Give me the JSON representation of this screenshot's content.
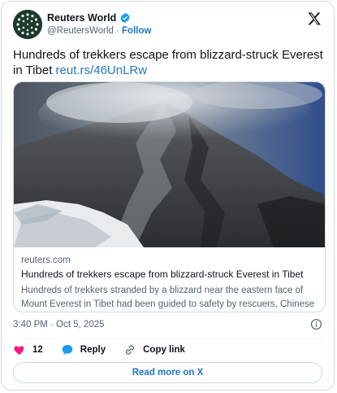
{
  "post": {
    "author_name": "Reuters World",
    "handle": "@ReutersWorld",
    "separator": "·",
    "follow_label": "Follow",
    "text": "Hundreds of trekkers escape from blizzard-struck Everest in Tibet",
    "short_link": "reut.rs/46UnLRw"
  },
  "link_card": {
    "domain": "reuters.com",
    "headline": "Hundreds of trekkers escape from blizzard-struck Everest in Tibet",
    "description": "Hundreds of trekkers stranded by a blizzard near the eastern face of Mount Everest in Tibet had been guided to safety by rescuers, Chinese ..."
  },
  "meta": {
    "timestamp": "3:40 PM · Oct 5, 2025"
  },
  "actions": {
    "like_count": "12",
    "reply_label": "Reply",
    "copy_label": "Copy link",
    "read_more_label": "Read more on X"
  },
  "colors": {
    "accent": "#1d77c2",
    "like": "#f91880",
    "verified": "#1d9bf0"
  },
  "icons": [
    "x-logo-icon",
    "verified-badge-icon",
    "info-icon",
    "heart-icon",
    "reply-bubble-icon",
    "link-icon"
  ]
}
